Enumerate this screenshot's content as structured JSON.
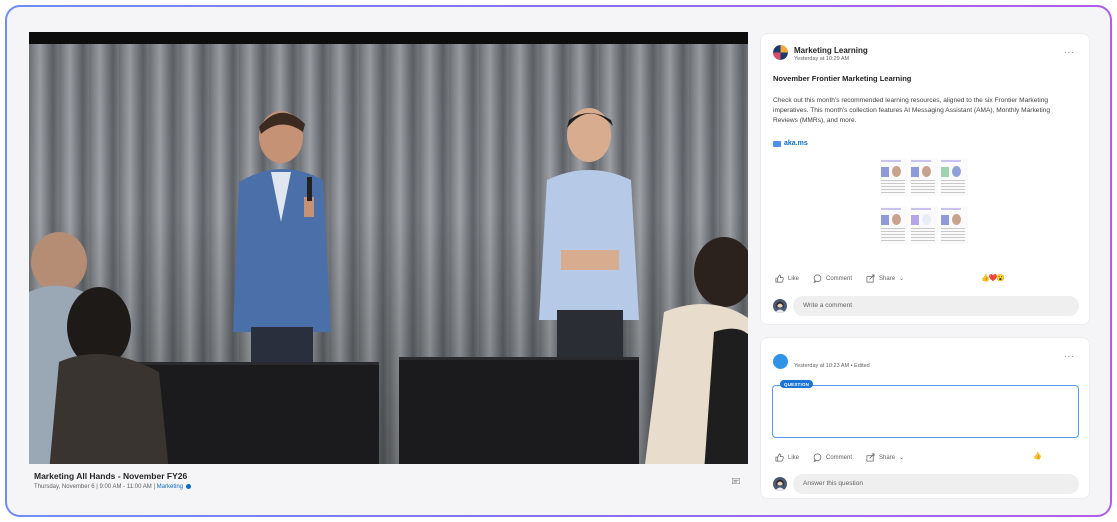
{
  "video": {
    "title": "Marketing All Hands - November FY26",
    "date": "Thursday, November 6",
    "time": "9:00 AM - 11:00 AM",
    "tag": "Marketing",
    "captions_icon": "captions-icon"
  },
  "post1": {
    "author": "Marketing Learning",
    "timestamp": "Yesterday at 10:29 AM",
    "title": "November Frontier Marketing Learning",
    "body": "Check out this month's recommended learning resources, aligned to the six Frontier Marketing imperatives. This month's collection features AI Messaging Assistant (AMA), Monthly Marketing Reviews (MMRs), and more.",
    "link": "aka.ms",
    "actions": {
      "like": "Like",
      "comment": "Comment",
      "share": "Share"
    },
    "reactions": "👍❤️😮",
    "comment_placeholder": "Write a comment"
  },
  "post2": {
    "timestamp": "Yesterday at 10:23 AM",
    "edited": "Edited",
    "badge": "QUESTION",
    "actions": {
      "like": "Like",
      "comment": "Comment",
      "share": "Share"
    },
    "reactions": "👍",
    "comment_placeholder": "Answer this question"
  },
  "colors": {
    "accent": "#0f6cbd",
    "frame_start": "#6e8ff5",
    "frame_end": "#b25ce8"
  }
}
